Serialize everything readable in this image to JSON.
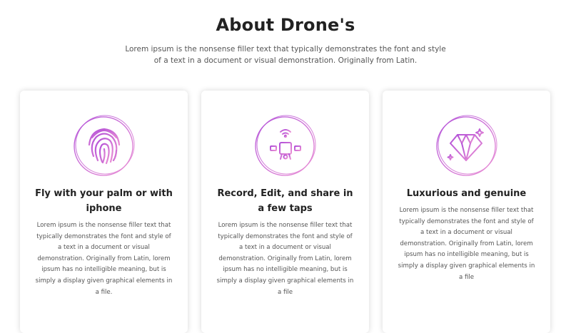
{
  "colors": {
    "accent_start": "#c455d9",
    "accent_end": "#e487d6",
    "title": "#222222",
    "text": "#555555"
  },
  "section": {
    "title": "About Drone's",
    "subtitle": "Lorem ipsum is the nonsense filler text that typically demonstrates the font and style of a text in a document or visual demonstration. Originally from Latin."
  },
  "cards": [
    {
      "icon": "fingerprint-icon",
      "title": "Fly with your palm or with iphone",
      "text": "Lorem ipsum is the nonsense filler text that typically demonstrates the font and style of a text in a document or visual demonstration. Originally from Latin, lorem ipsum has no intelligible meaning, but is simply a display given graphical elements in a file."
    },
    {
      "icon": "drone-icon",
      "title": "Record, Edit, and share in a few taps",
      "text": "Lorem ipsum is the nonsense filler text that typically demonstrates the font and style of a text in a document or visual demonstration. Originally from Latin, lorem ipsum has no intelligible meaning, but is simply a display given graphical elements in a file"
    },
    {
      "icon": "diamond-icon",
      "title": "Luxurious and genuine",
      "text": "Lorem ipsum is the nonsense filler text that typically demonstrates the font and style of a text in a document or visual demonstration. Originally from Latin, lorem ipsum has no intelligible meaning, but is simply a display given graphical elements in a file"
    }
  ]
}
